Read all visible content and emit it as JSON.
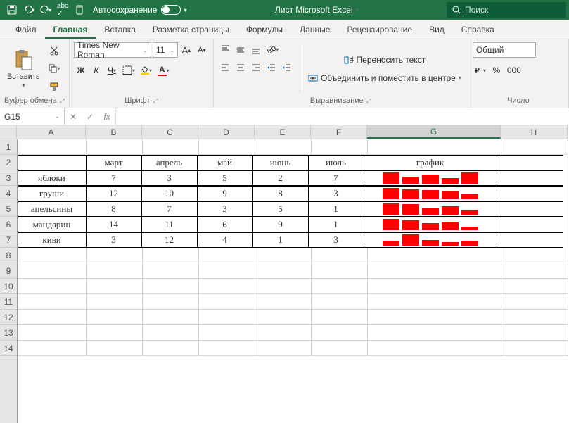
{
  "titlebar": {
    "autosave_label": "Автосохранение",
    "doc_title": "Лист Microsoft Excel",
    "search_placeholder": "Поиск"
  },
  "tabs": {
    "file": "Файл",
    "home": "Главная",
    "insert": "Вставка",
    "layout": "Разметка страницы",
    "formulas": "Формулы",
    "data": "Данные",
    "review": "Рецензирование",
    "view": "Вид",
    "help": "Справка"
  },
  "ribbon": {
    "clipboard": {
      "label": "Буфер обмена",
      "paste": "Вставить"
    },
    "font": {
      "label": "Шрифт",
      "family": "Times New Roman",
      "size": "11",
      "bold": "Ж",
      "italic": "К",
      "underline": "Ч"
    },
    "align": {
      "label": "Выравнивание",
      "wrap": "Переносить текст",
      "merge": "Объединить и поместить в центре"
    },
    "number": {
      "label": "Число",
      "format": "Общий",
      "percent": "%",
      "thousands": "000"
    }
  },
  "formula_bar": {
    "namebox": "G15",
    "cancel": "✕",
    "accept": "✓",
    "fx": "fx"
  },
  "columns": [
    "A",
    "B",
    "C",
    "D",
    "E",
    "F",
    "G",
    "H"
  ],
  "row_count": 14,
  "table": {
    "header_chart": "график",
    "months": [
      "март",
      "апрель",
      "май",
      "июнь",
      "июль"
    ],
    "rows": [
      {
        "name": "яблоки",
        "vals": [
          7,
          3,
          5,
          2,
          7
        ]
      },
      {
        "name": "груши",
        "vals": [
          12,
          10,
          9,
          8,
          3
        ]
      },
      {
        "name": "апельсины",
        "vals": [
          8,
          7,
          3,
          5,
          1
        ]
      },
      {
        "name": "мандарин",
        "vals": [
          14,
          11,
          6,
          9,
          1
        ]
      },
      {
        "name": "киви",
        "vals": [
          3,
          12,
          4,
          1,
          3
        ]
      }
    ]
  },
  "chart_data": {
    "type": "bar",
    "title": "график",
    "categories": [
      "март",
      "апрель",
      "май",
      "июнь",
      "июль"
    ],
    "series": [
      {
        "name": "яблоки",
        "values": [
          7,
          3,
          5,
          2,
          7
        ]
      },
      {
        "name": "груши",
        "values": [
          12,
          10,
          9,
          8,
          3
        ]
      },
      {
        "name": "апельсины",
        "values": [
          8,
          7,
          3,
          5,
          1
        ]
      },
      {
        "name": "мандарин",
        "values": [
          14,
          11,
          6,
          9,
          1
        ]
      },
      {
        "name": "киви",
        "values": [
          3,
          12,
          4,
          1,
          3
        ]
      }
    ]
  },
  "selected_cell": "G15"
}
